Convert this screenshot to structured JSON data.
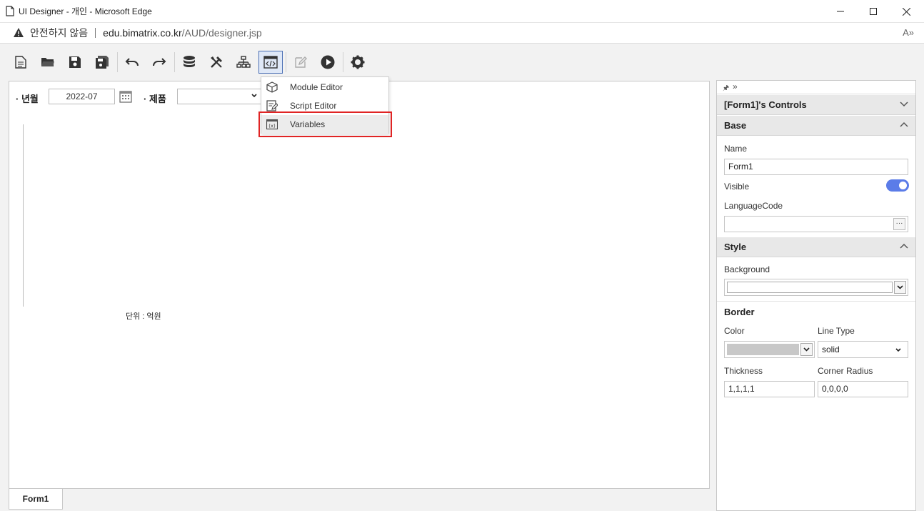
{
  "window": {
    "title": "UI Designer - 개인 - Microsoft Edge",
    "controls": {
      "minimize": "minimize",
      "maximize": "maximize",
      "close": "close"
    }
  },
  "address": {
    "security_text": "안전하지 않음",
    "url_host": "edu.bimatrix.co.kr",
    "url_path": "/AUD/designer.jsp",
    "read_aloud": "A»"
  },
  "toolbar": {
    "buttons": [
      "new-icon",
      "open-folder-icon",
      "save-icon",
      "save-all-icon",
      "undo-icon",
      "redo-icon",
      "database-icon",
      "tools-icon",
      "hierarchy-icon",
      "code-window-icon",
      "edit-icon",
      "play-icon",
      "gear-icon"
    ]
  },
  "canvas": {
    "period_label": "· 년월",
    "period_value": "2022-07",
    "product_label": "· 제품",
    "product_value": "",
    "unit_label": "단위 : 억원"
  },
  "menu": {
    "items": [
      {
        "label": "Module Editor",
        "icon": "module-icon"
      },
      {
        "label": "Script Editor",
        "icon": "script-icon"
      },
      {
        "label": "Variables",
        "icon": "variables-icon"
      }
    ]
  },
  "tabs": {
    "form1": "Form1"
  },
  "panel": {
    "controls_header": "[Form1]'s Controls",
    "base_header": "Base",
    "name_label": "Name",
    "name_value": "Form1",
    "visible_label": "Visible",
    "visible_on": true,
    "language_label": "LanguageCode",
    "language_value": "",
    "style_header": "Style",
    "background_label": "Background",
    "border_header": "Border",
    "color_label": "Color",
    "linetype_label": "Line Type",
    "linetype_value": "solid",
    "thickness_label": "Thickness",
    "thickness_value": "1,1,1,1",
    "radius_label": "Corner Radius",
    "radius_value": "0,0,0,0",
    "border_color": "#c8c8c8",
    "toggle_color": "#5b7ce8"
  },
  "colors": {
    "highlight": "#e02424",
    "active_button": "#4a6fb5"
  }
}
